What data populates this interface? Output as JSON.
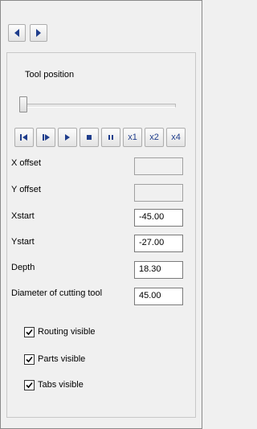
{
  "nav": {
    "prev_icon": "triangle-left-icon",
    "next_icon": "triangle-right-icon"
  },
  "tool_position": {
    "label": "Tool position",
    "slider_value": 0
  },
  "playback": {
    "icons": [
      "step-back-icon",
      "step-forward-icon",
      "play-icon",
      "stop-icon",
      "pause-icon"
    ],
    "speeds": [
      "x1",
      "x2",
      "x4"
    ]
  },
  "fields": {
    "x_offset": {
      "label": "X offset",
      "value": ""
    },
    "y_offset": {
      "label": "Y offset",
      "value": ""
    },
    "xstart": {
      "label": "Xstart",
      "value": "-45.00"
    },
    "ystart": {
      "label": "Ystart",
      "value": "-27.00"
    },
    "depth": {
      "label": "Depth",
      "value": "18.30"
    },
    "diameter": {
      "label": "Diameter of cutting tool",
      "value": "45.00"
    }
  },
  "checkboxes": {
    "routing": {
      "label": "Routing visible",
      "checked": true
    },
    "parts": {
      "label": "Parts visible",
      "checked": true
    },
    "tabs": {
      "label": "Tabs visible",
      "checked": true
    }
  },
  "colors": {
    "icon_blue": "#1f3d8c",
    "background": "#f0f0f0"
  }
}
